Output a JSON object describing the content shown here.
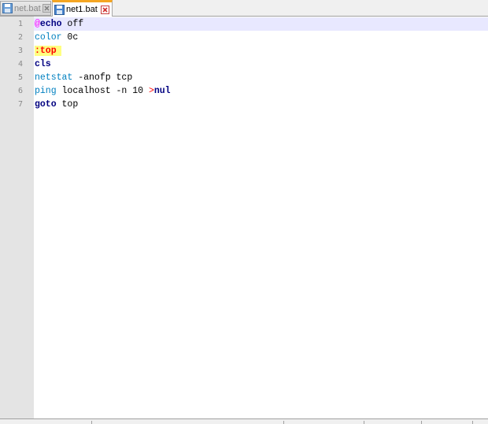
{
  "tabs": [
    {
      "label": "net.bat",
      "active": false
    },
    {
      "label": "net1.bat",
      "active": true
    }
  ],
  "icons": {
    "save": "floppy-disk-icon",
    "close": "close-icon"
  },
  "colors": {
    "keyword": "#000080",
    "command": "#0080c0",
    "at_sign": "#ff00ff",
    "label": "#ff0000",
    "label_bg": "#ffff80",
    "current_line": "#e8e8ff",
    "gutter": "#e4e4e4",
    "tab_accent": "#f5a623"
  },
  "line_numbers": [
    "1",
    "2",
    "3",
    "4",
    "5",
    "6",
    "7"
  ],
  "code": {
    "line1": {
      "at": "@",
      "keyword": "echo",
      "rest": " off"
    },
    "line2": {
      "command": "color",
      "rest": " 0c"
    },
    "line3": {
      "label": ":top"
    },
    "line4": {
      "keyword": "cls"
    },
    "line5": {
      "command": "netstat",
      "rest": " -anofp tcp"
    },
    "line6": {
      "command": "ping",
      "rest": " localhost -n 10 ",
      "redirect": ">",
      "keyword": "nul"
    },
    "line7": {
      "keyword": "goto",
      "rest": " top"
    }
  }
}
